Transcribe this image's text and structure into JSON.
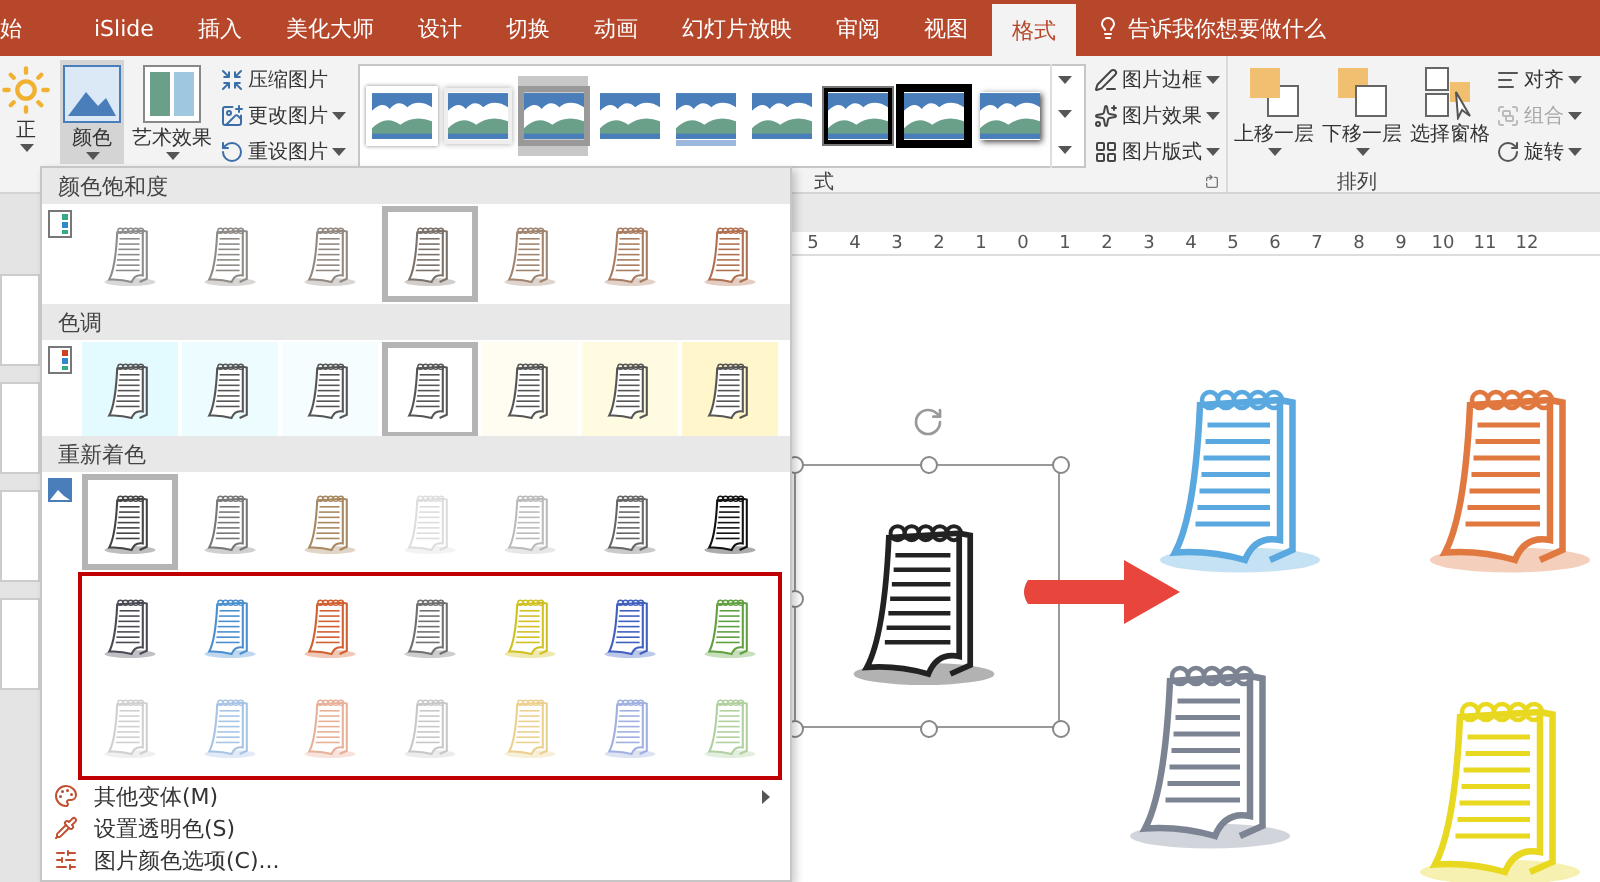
{
  "tabs": [
    {
      "label": "始",
      "selected": false
    },
    {
      "label": "iSlide",
      "selected": false
    },
    {
      "label": "插入",
      "selected": false
    },
    {
      "label": "美化大师",
      "selected": false
    },
    {
      "label": "设计",
      "selected": false
    },
    {
      "label": "切换",
      "selected": false
    },
    {
      "label": "动画",
      "selected": false
    },
    {
      "label": "幻灯片放映",
      "selected": false
    },
    {
      "label": "审阅",
      "selected": false
    },
    {
      "label": "视图",
      "selected": false
    },
    {
      "label": "格式",
      "selected": true
    }
  ],
  "tell_me": {
    "placeholder": "告诉我你想要做什么"
  },
  "ribbon": {
    "corrections_label": "正",
    "color_button": {
      "label": "颜色",
      "selected": true
    },
    "art_effects_button": {
      "label": "艺术效果"
    },
    "picture_buttons": [
      {
        "label": "压缩图片",
        "kind": "compress",
        "dropdown": false
      },
      {
        "label": "更改图片",
        "kind": "change",
        "dropdown": true
      },
      {
        "label": "重设图片",
        "kind": "reset",
        "dropdown": true
      }
    ],
    "picture_styles": [
      {
        "kind": "white-frame",
        "selected": false
      },
      {
        "kind": "soft-frame",
        "selected": false
      },
      {
        "kind": "grey-frame",
        "selected": true
      },
      {
        "kind": "plain",
        "selected": false
      },
      {
        "kind": "reflection",
        "selected": false
      },
      {
        "kind": "plain",
        "selected": false
      },
      {
        "kind": "black-frame",
        "selected": false
      },
      {
        "kind": "thick-black",
        "selected": false
      },
      {
        "kind": "shadow",
        "selected": false
      }
    ],
    "styles_group_label": "式",
    "format_buttons": [
      {
        "label": "图片边框",
        "kind": "border"
      },
      {
        "label": "图片效果",
        "kind": "effects"
      },
      {
        "label": "图片版式",
        "kind": "layout"
      }
    ],
    "arrange_buttons": [
      {
        "label": "上移一层",
        "kind": "forward"
      },
      {
        "label": "下移一层",
        "kind": "backward"
      },
      {
        "label": "选择窗格",
        "kind": "pane"
      }
    ],
    "arrange_small_buttons": [
      {
        "label": "对齐",
        "kind": "align",
        "disabled": false
      },
      {
        "label": "组合",
        "kind": "group",
        "disabled": true
      },
      {
        "label": "旋转",
        "kind": "rotate",
        "disabled": false
      }
    ],
    "arrange_group_label": "排列"
  },
  "color_menu": {
    "sections": [
      {
        "title": "颜色饱和度",
        "kind": "saturation",
        "rows": [
          [
            {
              "color": "#8c8c8c",
              "selected": false
            },
            {
              "color": "#8e8a86",
              "selected": false
            },
            {
              "color": "#928880",
              "selected": false
            },
            {
              "color": "#7a716a",
              "selected": true
            },
            {
              "color": "#a08470",
              "selected": false
            },
            {
              "color": "#a87c60",
              "selected": false
            },
            {
              "color": "#b07050",
              "selected": false
            }
          ]
        ]
      },
      {
        "title": "色调",
        "kind": "tone",
        "rows": [
          [
            {
              "color": "#e3fbff",
              "selected": false
            },
            {
              "color": "#edfdff",
              "selected": false
            },
            {
              "color": "#f5fdff",
              "selected": false
            },
            {
              "color": "#ffffff",
              "selected": true
            },
            {
              "color": "#fffdf2",
              "selected": false
            },
            {
              "color": "#fffbe0",
              "selected": false
            },
            {
              "color": "#fff6cc",
              "selected": false
            }
          ]
        ]
      },
      {
        "title": "重新着色",
        "kind": "recolor",
        "rows": [
          [
            {
              "color": "#444444",
              "selected": true
            },
            {
              "color": "#777777",
              "selected": false
            },
            {
              "color": "#a88860",
              "selected": false
            },
            {
              "color": "#dddddd",
              "selected": false
            },
            {
              "color": "#bbbbbb",
              "selected": false
            },
            {
              "color": "#666666",
              "selected": false
            },
            {
              "color": "#111111",
              "selected": false
            }
          ]
        ],
        "highlighted_rows": [
          [
            {
              "color": "#4a4a55",
              "selected": false
            },
            {
              "color": "#4a90d0",
              "selected": false
            },
            {
              "color": "#d06030",
              "selected": false
            },
            {
              "color": "#707070",
              "selected": false
            },
            {
              "color": "#d0c020",
              "selected": false
            },
            {
              "color": "#4060c0",
              "selected": false
            },
            {
              "color": "#60a040",
              "selected": false
            }
          ],
          [
            {
              "color": "#d0d0d0",
              "selected": false
            },
            {
              "color": "#a8c4e4",
              "selected": false
            },
            {
              "color": "#e8b098",
              "selected": false
            },
            {
              "color": "#c8c8c8",
              "selected": false
            },
            {
              "color": "#ecd090",
              "selected": false
            },
            {
              "color": "#a0b0e0",
              "selected": false
            },
            {
              "color": "#b0d0a0",
              "selected": false
            }
          ]
        ]
      }
    ],
    "menu_items": [
      {
        "label": "其他变体(M)",
        "kind": "variants",
        "submenu": true
      },
      {
        "label": "设置透明色(S)",
        "kind": "transparent",
        "submenu": false
      },
      {
        "label": "图片颜色选项(C)...",
        "kind": "options",
        "submenu": false
      }
    ]
  },
  "ruler": {
    "labels": [
      "5",
      "4",
      "3",
      "2",
      "1",
      "0",
      "1",
      "2",
      "3",
      "4",
      "5",
      "6",
      "7",
      "8",
      "9",
      "10",
      "11",
      "12"
    ]
  },
  "slide": {
    "original": {
      "color": "#222222",
      "selected": true
    },
    "results": [
      {
        "color": "#5aa8e0"
      },
      {
        "color": "#e07840"
      },
      {
        "color": "#7c8494"
      },
      {
        "color": "#e8d820"
      }
    ]
  }
}
